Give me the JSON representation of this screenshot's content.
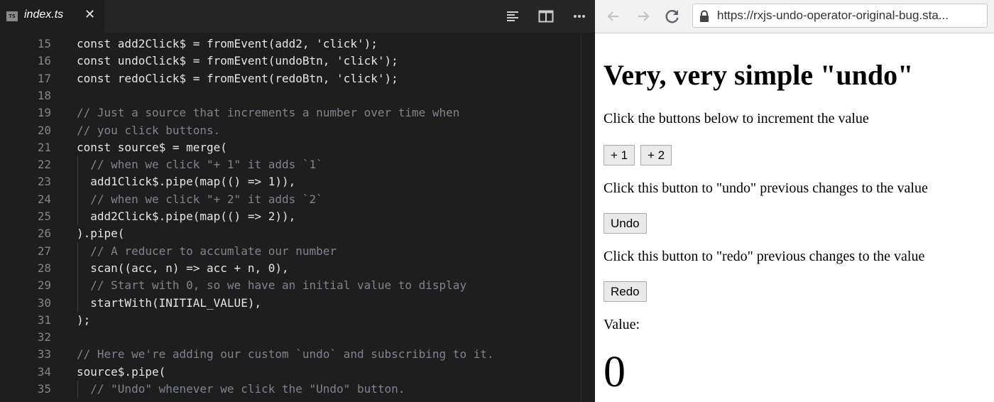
{
  "editor": {
    "tab": {
      "icon": "typescript-file-icon",
      "icon_text": "TS",
      "title": "index.ts",
      "close": "✕"
    },
    "toolbar": [
      "toggle-preview-icon",
      "split-editor-icon",
      "more-actions-icon"
    ],
    "lines": [
      {
        "n": "15",
        "text": "const add2Click$ = fromEvent(add2, 'click');",
        "kind": "code"
      },
      {
        "n": "16",
        "text": "const undoClick$ = fromEvent(undoBtn, 'click');",
        "kind": "code"
      },
      {
        "n": "17",
        "text": "const redoClick$ = fromEvent(redoBtn, 'click');",
        "kind": "code"
      },
      {
        "n": "18",
        "text": "",
        "kind": "code"
      },
      {
        "n": "19",
        "text": "// Just a source that increments a number over time when",
        "kind": "comment"
      },
      {
        "n": "20",
        "text": "// you click buttons.",
        "kind": "comment"
      },
      {
        "n": "21",
        "text": "const source$ = merge(",
        "kind": "code"
      },
      {
        "n": "22",
        "text": "  // when we click \"+ 1\" it adds `1`",
        "kind": "comment"
      },
      {
        "n": "23",
        "text": "  add1Click$.pipe(map(() => 1)),",
        "kind": "code"
      },
      {
        "n": "24",
        "text": "  // when we click \"+ 2\" it adds `2`",
        "kind": "comment"
      },
      {
        "n": "25",
        "text": "  add2Click$.pipe(map(() => 2)),",
        "kind": "code"
      },
      {
        "n": "26",
        "text": ").pipe(",
        "kind": "code"
      },
      {
        "n": "27",
        "text": "  // A reducer to accumlate our number",
        "kind": "comment"
      },
      {
        "n": "28",
        "text": "  scan((acc, n) => acc + n, 0),",
        "kind": "code"
      },
      {
        "n": "29",
        "text": "  // Start with 0, so we have an initial value to display",
        "kind": "comment"
      },
      {
        "n": "30",
        "text": "  startWith(INITIAL_VALUE),",
        "kind": "code"
      },
      {
        "n": "31",
        "text": ");",
        "kind": "code"
      },
      {
        "n": "32",
        "text": "",
        "kind": "code"
      },
      {
        "n": "33",
        "text": "// Here we're adding our custom `undo` and subscribing to it.",
        "kind": "comment"
      },
      {
        "n": "34",
        "text": "source$.pipe(",
        "kind": "code"
      },
      {
        "n": "35",
        "text": "  // \"Undo\" whenever we click the \"Undo\" button.",
        "kind": "comment"
      }
    ]
  },
  "browser": {
    "url": "https://rxjs-undo-operator-original-bug.sta...",
    "nav_icons": [
      "back-arrow-icon",
      "forward-arrow-icon",
      "reload-icon",
      "lock-icon"
    ],
    "page": {
      "heading": "Very, very simple \"undo\"",
      "increment_text": "Click the buttons below to increment the value",
      "plus_one_label": "+ 1",
      "plus_two_label": "+ 2",
      "undo_text": "Click this button to \"undo\" previous changes to the value",
      "undo_label": "Undo",
      "redo_text": "Click this button to \"redo\" previous changes to the value",
      "redo_label": "Redo",
      "value_label": "Value:",
      "value": "0"
    }
  },
  "colors": {
    "editor_bg": "#1e1e1e",
    "code_text": "#e6e6e6",
    "comment_text": "#7f848e",
    "line_number": "#858585"
  }
}
